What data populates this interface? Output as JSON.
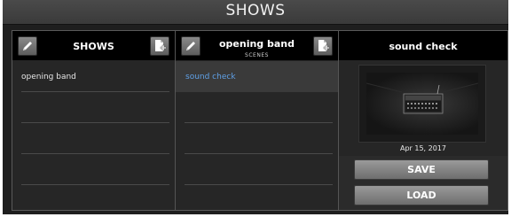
{
  "window": {
    "title": "SHOWS"
  },
  "shows": {
    "header": "SHOWS",
    "items": [
      {
        "label": "opening band"
      },
      {
        "label": ""
      },
      {
        "label": ""
      },
      {
        "label": ""
      }
    ]
  },
  "scenes": {
    "header": "opening band",
    "subheader": "SCENES",
    "items": [
      {
        "label": "sound check",
        "selected": true
      },
      {
        "label": ""
      },
      {
        "label": ""
      },
      {
        "label": ""
      }
    ]
  },
  "detail": {
    "title": "sound check",
    "date": "Apr 15, 2017",
    "save_label": "SAVE",
    "load_label": "LOAD"
  },
  "colors": {
    "background": "#1e1e1e",
    "header": "#000000",
    "selected_text": "#5fa0e6",
    "button": "#8a8a8a"
  },
  "icons": [
    "pencil-icon",
    "new-document-icon",
    "mixer-device-image"
  ]
}
